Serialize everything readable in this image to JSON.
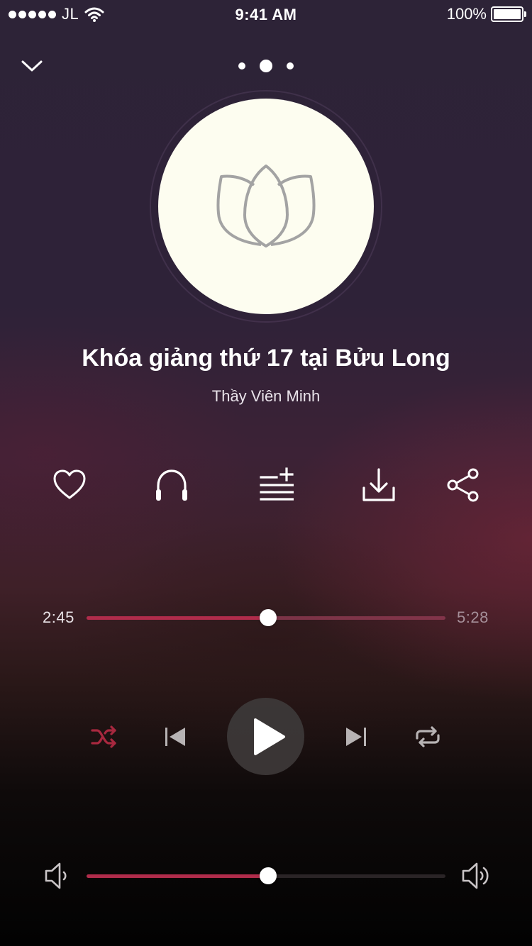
{
  "status_bar": {
    "carrier": "JL",
    "time": "9:41 AM",
    "battery": "100%",
    "icons": [
      "signal-dots-icon",
      "wifi-icon",
      "battery-icon"
    ]
  },
  "nav": {
    "collapse_icon": "chevron-down-icon",
    "pages": 3,
    "active_page": 2
  },
  "artwork": {
    "icon": "lotus-icon"
  },
  "track": {
    "title": "Khóa giảng thứ 17 tại Bửu Long",
    "artist": "Thầy Viên Minh"
  },
  "actions": [
    "heart-icon",
    "headphones-icon",
    "add-to-playlist-icon",
    "download-icon",
    "share-icon"
  ],
  "progress": {
    "elapsed": "2:45",
    "total": "5:28",
    "fraction": 0.505
  },
  "controls": {
    "icons": [
      "shuffle-icon",
      "previous-icon",
      "play-icon",
      "next-icon",
      "repeat-icon"
    ],
    "shuffle_active": true
  },
  "volume": {
    "fraction": 0.505,
    "icons": [
      "volume-low-icon",
      "volume-high-icon"
    ]
  },
  "colors": {
    "accent": "#b02c4b",
    "shuffle_active": "#a8283f",
    "artwork_bg": "#fdfdf0",
    "lotus_stroke": "#a3a3a3"
  }
}
